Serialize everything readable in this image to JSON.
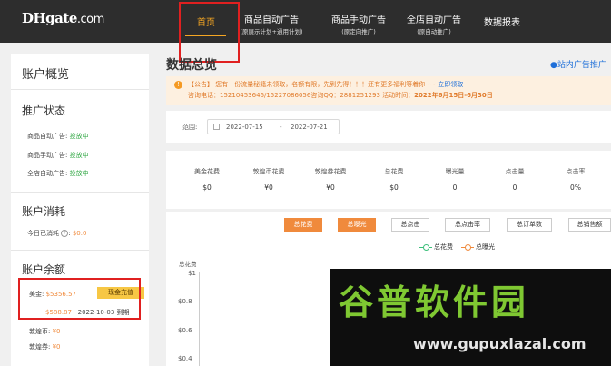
{
  "header": {
    "logo": {
      "main": "DHgate",
      "suffix": ".com"
    },
    "nav": [
      {
        "label": "首页",
        "sub": ""
      },
      {
        "label": "商品自动广告",
        "sub": "(原展示计划+通用计划)"
      },
      {
        "label": "商品手动广告",
        "sub": "(原定向推广)"
      },
      {
        "label": "全店自动广告",
        "sub": "(原自动推广)"
      },
      {
        "label": "数据报表",
        "sub": ""
      }
    ],
    "active_color": "#f5a623"
  },
  "sidebar": {
    "overview_title": "账户概览",
    "promo_title": "推广状态",
    "promo_rows": [
      {
        "label": "商品自动广告:",
        "status": "投放中"
      },
      {
        "label": "商品手动广告:",
        "status": "投放中"
      },
      {
        "label": "全店自动广告:",
        "status": "投放中"
      }
    ],
    "spend_title": "账户消耗",
    "spend_label": "今日已消耗",
    "spend_value": "$0.0",
    "balance_title": "账户余额",
    "usd_label": "美金:",
    "usd_value": "$5356.57",
    "recharge_label": "现金充值",
    "expiring_amount": "$588.87",
    "expiring_date": "2022-10-03 到期",
    "coin_label": "敦煌币:",
    "coin_value": "¥0",
    "coupon_label": "敦煌券:",
    "coupon_value": "¥0"
  },
  "main": {
    "title": "数据总览",
    "ad_link": "●站内广告推广",
    "notice": {
      "icon": "!",
      "line1": "【公告】 您有一份流量秘籍未领取，名额有限，先到先得！！！还有更多福利等着你~~",
      "line1_link": "立即领取",
      "line2": "咨询电话：15210453646/15227086056咨询QQ：2881251293 活动时间：",
      "line2_bold": "2022年6月15日-6月30日"
    },
    "range": {
      "label": "范围:",
      "start": "2022-07-15",
      "sep": "-",
      "end": "2022-07-21"
    },
    "stats": [
      {
        "label": "美金花费",
        "value": "$0"
      },
      {
        "label": "敦煌币花费",
        "value": "¥0"
      },
      {
        "label": "敦煌券花费",
        "value": "¥0"
      },
      {
        "label": "总花费",
        "value": "$0"
      },
      {
        "label": "曝光量",
        "value": "0"
      },
      {
        "label": "点击量",
        "value": "0"
      },
      {
        "label": "点击率",
        "value": "0%"
      }
    ],
    "metric_buttons": [
      {
        "label": "总花费",
        "active": true
      },
      {
        "label": "总曝光",
        "active": true
      },
      {
        "label": "总点击",
        "active": false
      },
      {
        "label": "总点击率",
        "active": false
      },
      {
        "label": "总订单数",
        "active": false
      },
      {
        "label": "总销售额",
        "active": false
      }
    ],
    "accent": "#f08a3c"
  },
  "chart_data": {
    "type": "line",
    "series": [
      {
        "name": "总花费",
        "color": "#3cbf7a",
        "values": []
      },
      {
        "name": "总曝光",
        "color": "#f08a3c",
        "values": []
      }
    ],
    "ylabel": "总花费",
    "yticks": [
      "$1",
      "$0.8",
      "$0.6",
      "$0.4"
    ]
  },
  "watermark": {
    "text": "谷普软件园",
    "url": "www.gupuxlazal.com"
  }
}
